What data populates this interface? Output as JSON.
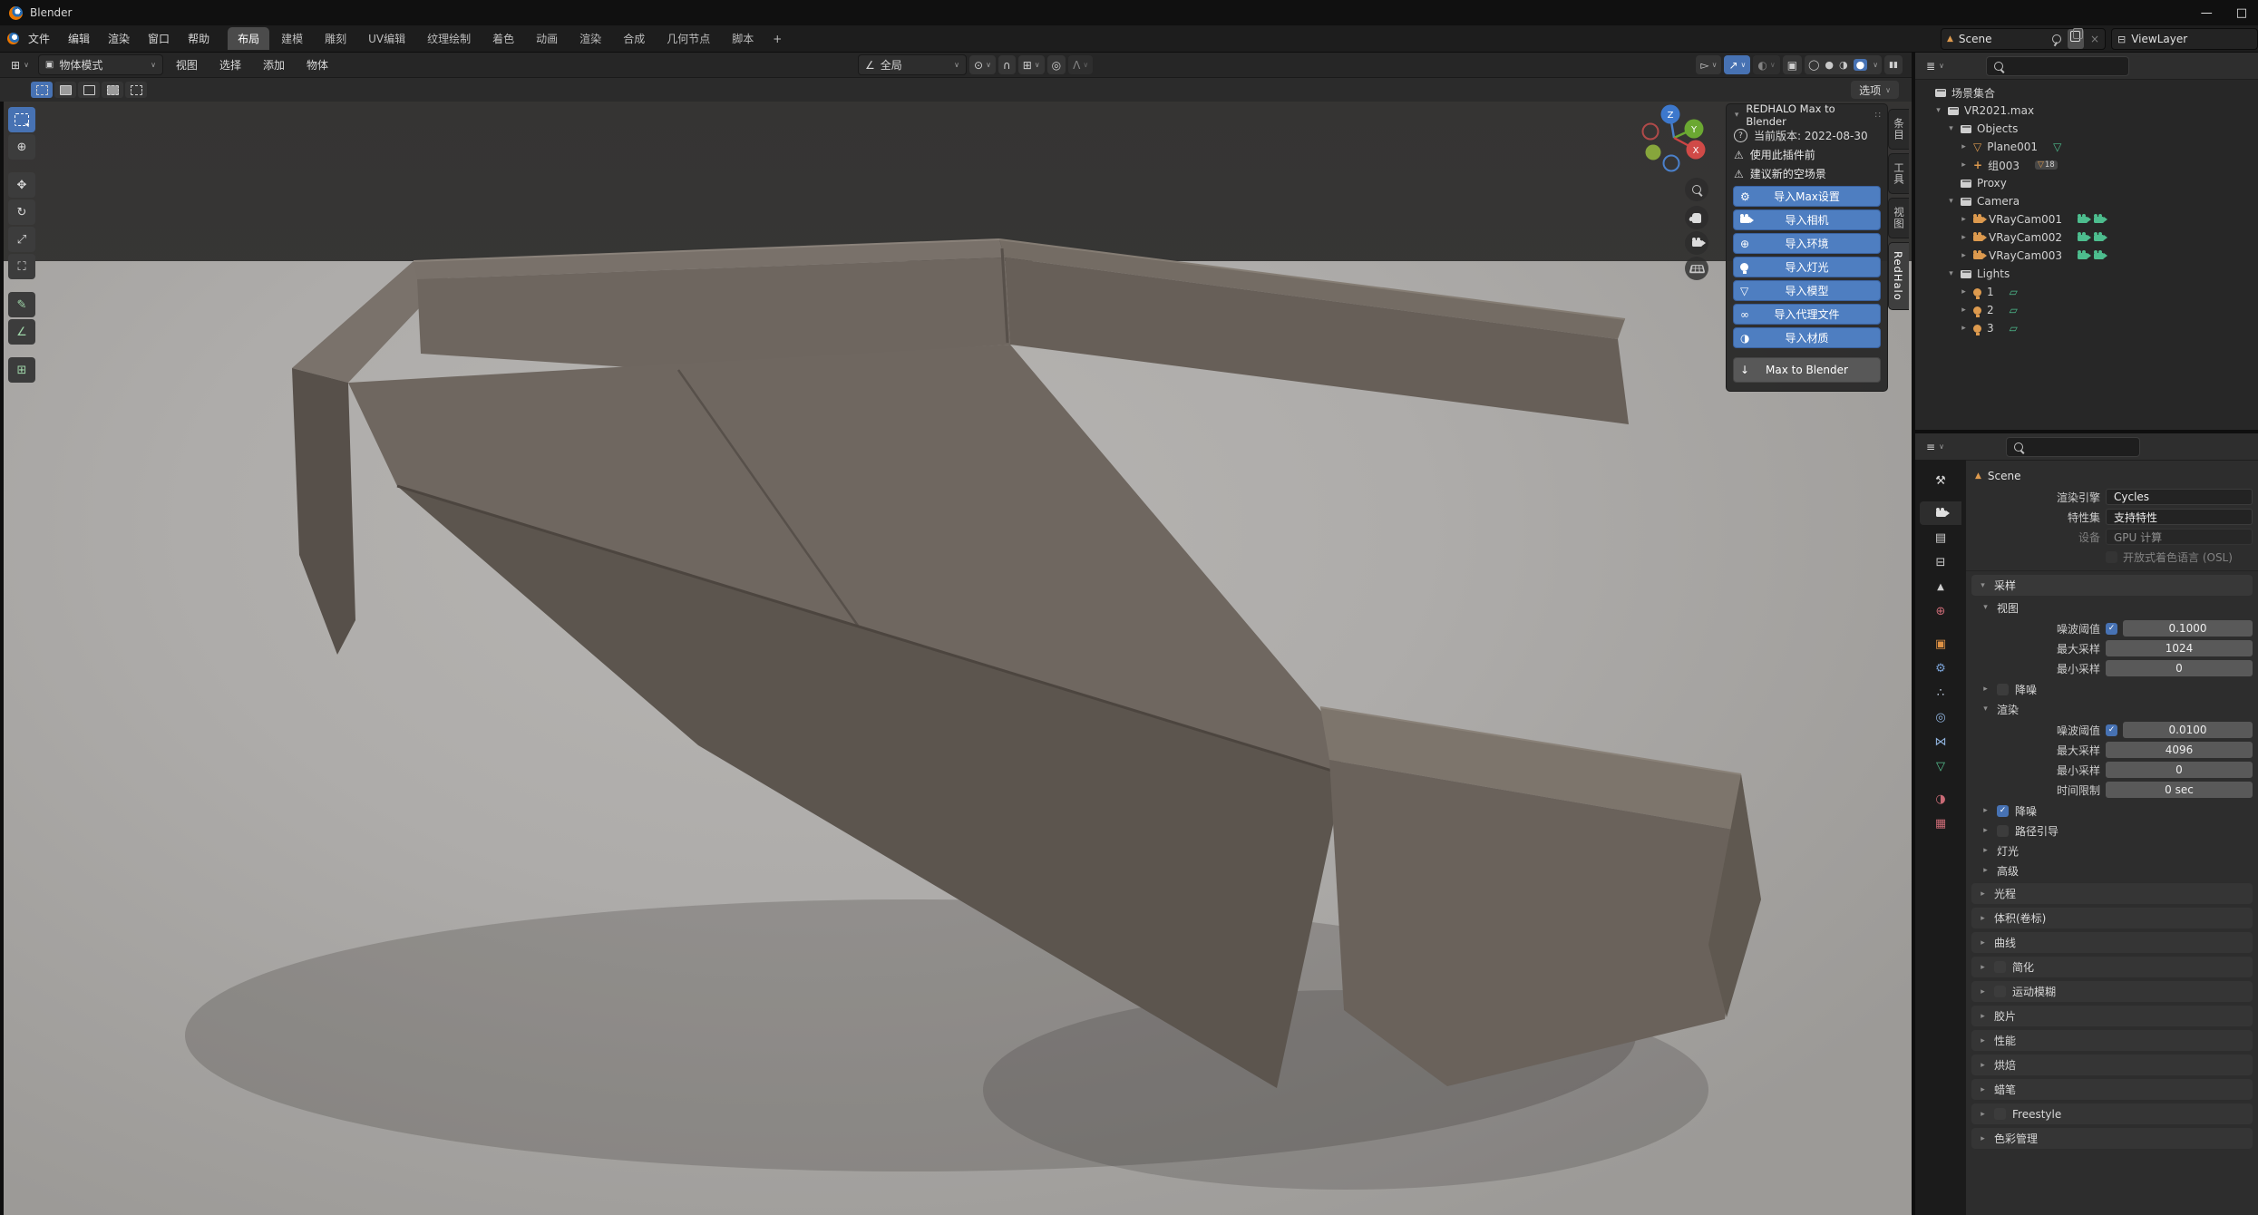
{
  "window": {
    "title": "Blender",
    "minimize": "—",
    "maximize": "□"
  },
  "icons": {
    "chevron": "∨",
    "expand_open": "▾",
    "expand_closed": "▸",
    "warning": "⚠",
    "question": "?",
    "gear": "⚙",
    "check": "✓",
    "close": "×",
    "plus": "+",
    "mesh": "▽",
    "orientation": "∠",
    "pivot": "⊙",
    "snap": "∩",
    "falloff": "Λ",
    "prop_edit": "◎",
    "wire": "◯",
    "solid": "●",
    "matprev": "◑",
    "xray": "▣",
    "pause": "▮▮",
    "gizmo_arrow": "↗",
    "overlays": "◐",
    "visibility": "▻",
    "editor_vp": "⊞",
    "editor_outliner": "≣",
    "editor_props": "≡",
    "world": "⊕",
    "link": "∞",
    "download": "↓",
    "empty_axes": "+",
    "arealight": "▱",
    "tool": "⚒",
    "output": "▤",
    "viewlayer": "⊟",
    "scene_tri": "▲",
    "object": "▣",
    "modifier": "⚙",
    "particles": "∴",
    "physics": "◎",
    "constraints": "⋈",
    "material": "◑",
    "texture": "▦",
    "move": "✥",
    "rotate": "↻",
    "scale": "⤢",
    "transform": "⛶",
    "annotate": "✎",
    "measure": "∠",
    "addcube": "⊞",
    "cursor": "⊕",
    "grip": "∷"
  },
  "topbar": {
    "menus": [
      "文件",
      "编辑",
      "渲染",
      "窗口",
      "帮助"
    ],
    "workspaces": [
      "布局",
      "建模",
      "雕刻",
      "UV编辑",
      "纹理绘制",
      "着色",
      "动画",
      "渲染",
      "合成",
      "几何节点",
      "脚本"
    ],
    "add_workspace": "+",
    "scene_label": "Scene",
    "viewlayer_label": "ViewLayer"
  },
  "viewport": {
    "mode": "物体模式",
    "menus": [
      "视图",
      "选择",
      "添加",
      "物体"
    ],
    "orientation": "全局",
    "options": "选项",
    "gizmo": {
      "x": "X",
      "y": "Y",
      "z": "Z"
    }
  },
  "sidebar_tabs": [
    "条目",
    "工具",
    "视图",
    "RedHalo"
  ],
  "redhalo": {
    "title": "REDHALO Max to Blender",
    "version": "当前版本: 2022-08-30",
    "warning1": "使用此插件前",
    "warning2": "建议新的空场景",
    "buttons": [
      "导入Max设置",
      "导入相机",
      "导入环境",
      "导入灯光",
      "导入模型",
      "导入代理文件",
      "导入材质"
    ],
    "footer": "Max to Blender"
  },
  "outliner": {
    "root": "场景集合",
    "instance_count": "18",
    "rows": [
      {
        "label": "VR2021.max"
      },
      {
        "label": "Objects"
      },
      {
        "label": "Plane001"
      },
      {
        "label": "组003"
      },
      {
        "label": "Proxy"
      },
      {
        "label": "Camera"
      },
      {
        "label": "VRayCam001"
      },
      {
        "label": "VRayCam002"
      },
      {
        "label": "VRayCam003"
      },
      {
        "label": "Lights"
      },
      {
        "label": "1"
      },
      {
        "label": "2"
      },
      {
        "label": "3"
      }
    ]
  },
  "properties": {
    "breadcrumb": "Scene",
    "engine_label": "渲染引擎",
    "engine_value": "Cycles",
    "featureset_label": "特性集",
    "featureset_value": "支持特性",
    "device_label": "设备",
    "device_value": "GPU 计算",
    "osl_label": "开放式着色语言 (OSL)",
    "sampling_title": "采样",
    "viewport_title": "视图",
    "noise_label": "噪波阈值",
    "viewport_noise": "0.1000",
    "max_label": "最大采样",
    "viewport_max": "1024",
    "min_label": "最小采样",
    "viewport_min": "0",
    "denoise_label": "降噪",
    "render_title": "渲染",
    "render_noise": "0.0100",
    "render_max": "4096",
    "render_min": "0",
    "time_label": "时间限制",
    "time_value": "0 sec",
    "pathguide_label": "路径引导",
    "lights_label": "灯光",
    "advanced_label": "高级",
    "sections": [
      "光程",
      "体积(卷标)",
      "曲线",
      "简化",
      "运动模糊",
      "胶片",
      "性能",
      "烘焙",
      "蜡笔",
      "Freestyle",
      "色彩管理"
    ]
  },
  "colors": {
    "accent": "#4772b3",
    "orange": "#dd9a4e",
    "green": "#4dbd8e"
  }
}
